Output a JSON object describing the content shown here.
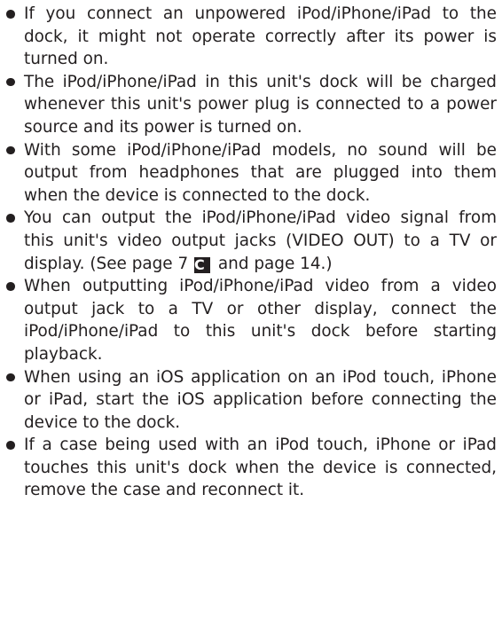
{
  "notes": {
    "items": [
      {
        "text": "If you connect an unpowered iPod/iPhone/iPad to the dock, it might not operate correctly after its power is turned on."
      },
      {
        "text": "The iPod/iPhone/iPad in this unit's dock will be charged whenever this unit's power plug is connected to a power source and its power is turned on."
      },
      {
        "text": "With some iPod/iPhone/iPad models, no sound will be output from headphones that are plugged into them when the device is connected to the dock."
      },
      {
        "text_before": "You can output the iPod/iPhone/iPad video signal from this unit's video output jacks (VIDEO OUT) to a TV or display. (See page 7",
        "badge": "C",
        "text_after": "and page 14.)"
      },
      {
        "text": "When outputting iPod/iPhone/iPad video from a video output jack to a TV or other display, connect the iPod/iPhone/iPad to this unit's dock before starting playback."
      },
      {
        "text": "When using an iOS application on an iPod touch, iPhone or iPad, start the iOS application before connecting the device to the dock."
      },
      {
        "text": "If a case being used with an iPod touch, iPhone or iPad touches this unit's dock when the device is connected, remove the case and reconnect it."
      }
    ]
  }
}
